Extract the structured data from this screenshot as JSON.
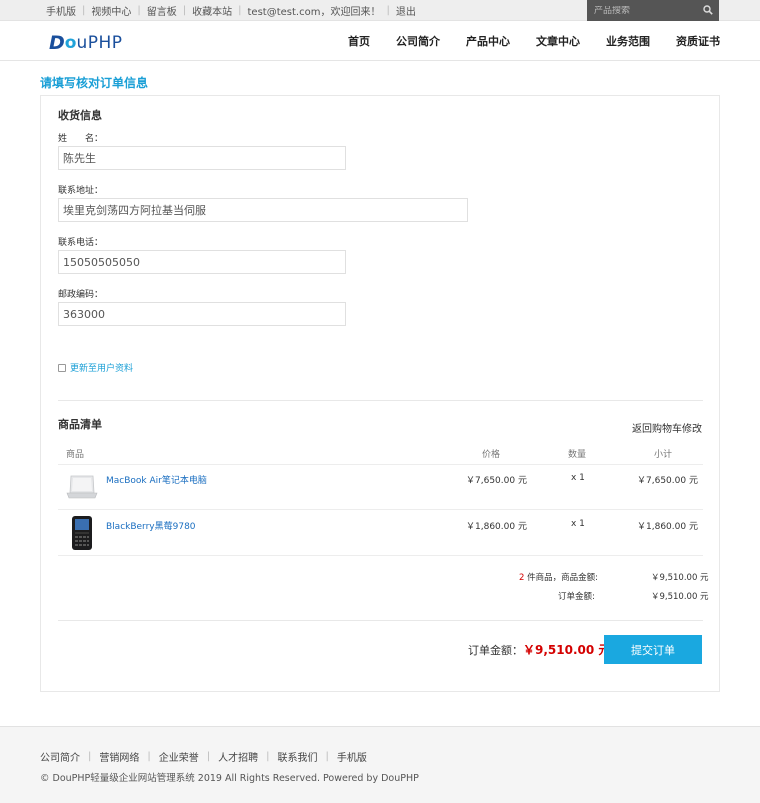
{
  "topbar": {
    "links": [
      "手机版",
      "视频中心",
      "留言板",
      "收藏本站",
      "test@test.com，欢迎回来！",
      "退出"
    ],
    "search_placeholder": "产品搜索"
  },
  "logo": {
    "d": "D",
    "o": "o",
    "rest": "uPHP"
  },
  "nav": [
    "首页",
    "公司简介",
    "产品中心",
    "文章中心",
    "业务范围",
    "资质证书"
  ],
  "page_title": "请填写核对订单信息",
  "shipping": {
    "title": "收货信息",
    "name_label": "姓　　名：",
    "name_value": "陈先生",
    "address_label": "联系地址：",
    "address_value": "埃里克剑荡四方阿拉基当伺服",
    "phone_label": "联系电话：",
    "phone_value": "15050505050",
    "zip_label": "邮政编码：",
    "zip_value": "363000",
    "update_label": "更新至用户资料"
  },
  "products": {
    "title": "商品清单",
    "back_link": "返回购物车修改",
    "headers": {
      "product": "商品",
      "price": "价格",
      "qty": "数量",
      "subtotal": "小计"
    },
    "rows": [
      {
        "name": "MacBook Air笔记本电脑",
        "price": "￥7,650.00 元",
        "qty": "x 1",
        "subtotal": "￥7,650.00 元"
      },
      {
        "name": "BlackBerry黑莓9780",
        "price": "￥1,860.00 元",
        "qty": "x 1",
        "subtotal": "￥1,860.00 元"
      }
    ],
    "count": "2",
    "count_suffix": " 件商品，商品金额:",
    "goods_amount": "￥9,510.00 元",
    "order_amount_label": "订单金额:",
    "order_amount": "￥9,510.00 元"
  },
  "total": {
    "label": "订单金额：",
    "value": "￥9,510.00 元",
    "submit_label": "提交订单"
  },
  "footer": {
    "links": [
      "公司简介",
      "营销网络",
      "企业荣誉",
      "人才招聘",
      "联系我们",
      "手机版"
    ],
    "copyright": "© DouPHP轻量级企业网站管理系统 2019 All Rights Reserved. Powered by DouPHP"
  },
  "colors": {
    "accent": "#1aa8e0",
    "price_red": "#d40000",
    "link_blue": "#1a6ec0"
  }
}
